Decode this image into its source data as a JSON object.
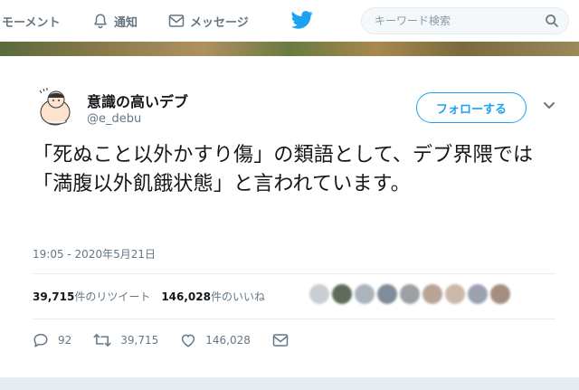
{
  "nav": {
    "moments_label": "モーメント",
    "notifications_label": "通知",
    "messages_label": "メッセージ",
    "search_placeholder": "キーワード検索"
  },
  "tweet": {
    "display_name": "意識の高いデブ",
    "handle": "@e_debu",
    "follow_label": "フォローする",
    "text": "「死ぬこと以外かすり傷」の類語として、デブ界隈では「満腹以外飢餓状態」と言われています。",
    "timestamp": "19:05 - 2020年5月21日",
    "retweets_count": "39,715",
    "retweets_label": "件のリツイート",
    "likes_count": "146,028",
    "likes_label": "件のいいね",
    "reply_count": "92",
    "retweet_action_count": "39,715",
    "like_action_count": "146,028"
  },
  "colors": {
    "accent": "#1da1f2",
    "muted": "#657786",
    "text": "#14171a"
  },
  "icons": {
    "nav": [
      "moments-icon",
      "bell-icon",
      "envelope-icon",
      "twitter-bird-icon",
      "search-icon"
    ],
    "actions": [
      "reply-icon",
      "retweet-icon",
      "like-icon",
      "dm-icon"
    ]
  }
}
